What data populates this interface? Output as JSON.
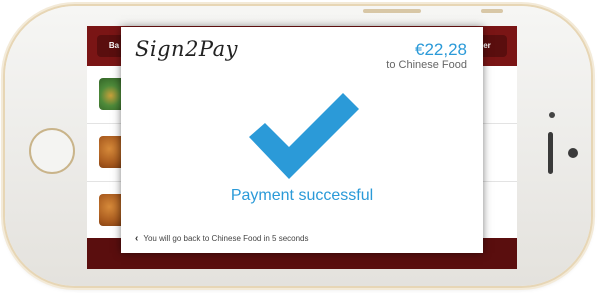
{
  "app": {
    "back_label": "Ba",
    "order_label": "rder"
  },
  "payment": {
    "brand": "Sign2Pay",
    "amount": "€22,28",
    "merchant": "to Chinese Food",
    "status": "Payment successful",
    "redirect_message": "You will go back to Chinese Food in 5 seconds",
    "status_icon": "checkmark-icon"
  },
  "colors": {
    "accent": "#2b9ad8",
    "app_bar": "#7a1515"
  }
}
